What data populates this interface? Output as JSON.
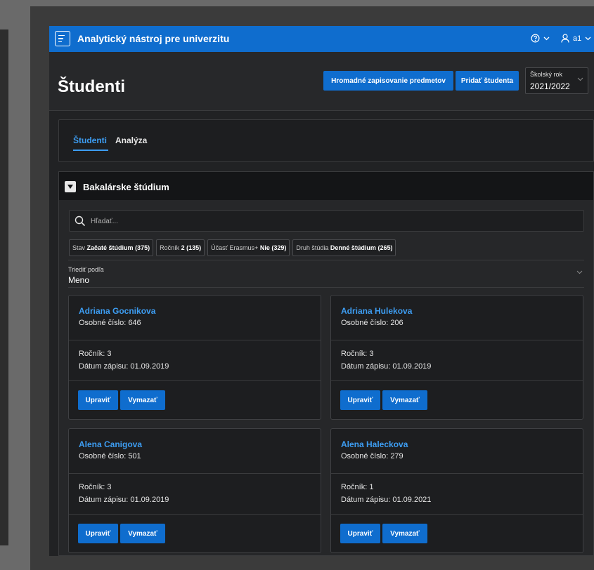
{
  "topbar": {
    "title": "Analytický nástroj pre univerzitu",
    "user_label": "a1",
    "accent": "#0f6dce"
  },
  "header": {
    "title": "Študenti",
    "bulk_button": "Hromadné zapisovanie predmetov",
    "add_button": "Pridať študenta",
    "year_select": {
      "label": "Školský rok",
      "value": "2021/2022"
    }
  },
  "tabs": [
    {
      "label": "Študenti",
      "active": true
    },
    {
      "label": "Analýza",
      "active": false
    }
  ],
  "region": {
    "title": "Bakalárske štúdium",
    "search": {
      "placeholder": "Hľadať..."
    },
    "chips": [
      {
        "label": "Stav",
        "value": "Začaté štúdium",
        "count": "(375)"
      },
      {
        "label": "Ročník",
        "value": "2",
        "count": "(135)"
      },
      {
        "label": "Účasť Erasmus+",
        "value": "Nie",
        "count": "(329)"
      },
      {
        "label": "Druh štúdia",
        "value": "Denné štúdium",
        "count": "(265)"
      }
    ],
    "sort": {
      "label": "Triediť podľa",
      "value": "Meno"
    }
  },
  "students": [
    {
      "name": "Adriana Gocnikova",
      "id": "Osobné číslo: 646",
      "year": "Ročník: 3",
      "date": "Dátum zápisu: 01.09.2019"
    },
    {
      "name": "Adriana Hulekova",
      "id": "Osobné číslo: 206",
      "year": "Ročník: 3",
      "date": "Dátum zápisu: 01.09.2019"
    },
    {
      "name": "Alena Canigova",
      "id": "Osobné číslo: 501",
      "year": "Ročník: 3",
      "date": "Dátum zápisu: 01.09.2019"
    },
    {
      "name": "Alena Haleckova",
      "id": "Osobné číslo: 279",
      "year": "Ročník: 1",
      "date": "Dátum zápisu: 01.09.2021"
    }
  ],
  "card_actions": {
    "edit": "Upraviť",
    "delete": "Vymazať"
  }
}
